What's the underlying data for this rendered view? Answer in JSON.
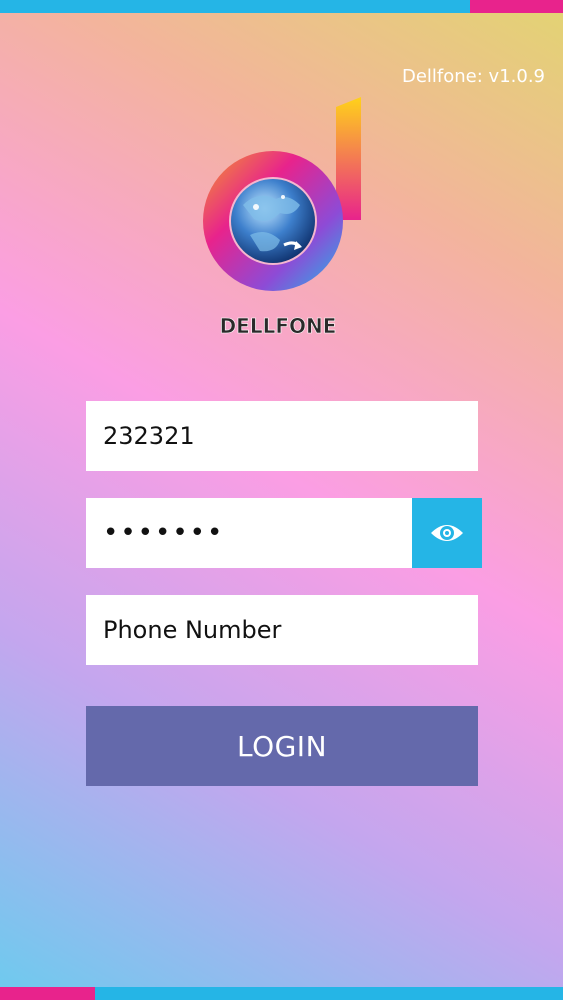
{
  "app": {
    "version_text": "Dellfone: v1.0.9",
    "logo_text": "DELLFONE"
  },
  "form": {
    "username_value": "232321",
    "password_value": "•••••••",
    "phone_placeholder": "Phone Number",
    "login_label": "LOGIN"
  },
  "icons": {
    "logo": "dellfone-logo-icon",
    "password_toggle": "eye-icon"
  },
  "colors": {
    "accent_blue": "#25b5e6",
    "accent_pink": "#e8238c",
    "login_button": "#6469ab",
    "field_background": "#ffffff"
  }
}
